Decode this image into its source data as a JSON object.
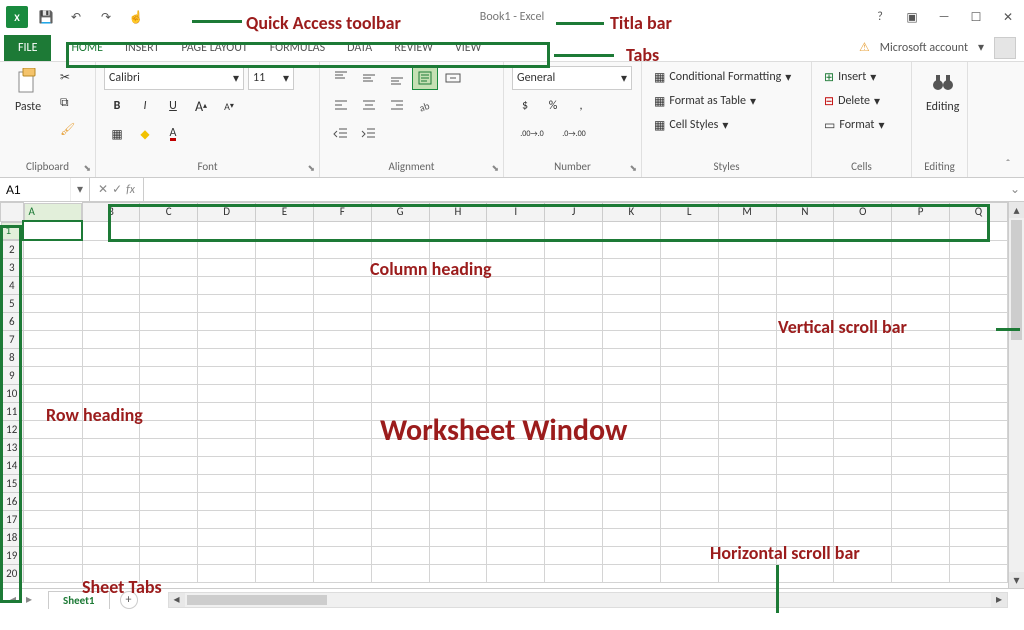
{
  "titlebar": {
    "app_letter": "X",
    "title": "Book1 - Excel",
    "help_glyph": "?",
    "restore_glyph": "▣",
    "min_glyph": "—",
    "max_glyph": "☐",
    "close_glyph": "✕"
  },
  "qat": {
    "save_glyph": "💾",
    "undo_glyph": "↶",
    "redo_glyph": "↷",
    "touch_glyph": "☝"
  },
  "tabs": {
    "file": "FILE",
    "items": [
      {
        "label": "HOME"
      },
      {
        "label": "INSERT"
      },
      {
        "label": "PAGE LAYOUT"
      },
      {
        "label": "FORMULAS"
      },
      {
        "label": "DATA"
      },
      {
        "label": "REVIEW"
      },
      {
        "label": "VIEW"
      }
    ]
  },
  "account": {
    "warn_glyph": "⚠",
    "label": "Microsoft account",
    "dd_glyph": "▾"
  },
  "ribbon": {
    "clipboard": {
      "paste": "Paste",
      "cut_glyph": "✂",
      "copy_glyph": "⧉",
      "painter_glyph": "🖌",
      "label": "Clipboard"
    },
    "font": {
      "name": "Calibri",
      "size": "11",
      "bold": "B",
      "italic": "I",
      "underline": "U",
      "grow": "A",
      "shrink": "A",
      "border_glyph": "▦",
      "fill_glyph": "◆",
      "color_glyph": "A",
      "label": "Font",
      "dd": "▾"
    },
    "alignment": {
      "label": "Alignment"
    },
    "number": {
      "format": "General",
      "currency": "$",
      "percent": "%",
      "comma": ",",
      "inc": ".00→.0",
      "dec": ".0→.00",
      "label": "Number",
      "dd": "▾"
    },
    "styles": {
      "cond": "Conditional Formatting",
      "table": "Format as Table",
      "cell": "Cell Styles",
      "label": "Styles",
      "dd": "▾"
    },
    "cells": {
      "insert": "Insert",
      "delete": "Delete",
      "format": "Format",
      "label": "Cells",
      "dd": "▾"
    },
    "editing": {
      "label": "Editing"
    },
    "launcher": "⬊",
    "collapse_glyph": "ˆ"
  },
  "namebox": {
    "value": "A1",
    "dd": "▾"
  },
  "fxbar": {
    "cancel": "✕",
    "enter": "✓",
    "fx": "fx",
    "value": "",
    "expand": "⌄"
  },
  "grid": {
    "cols": [
      "A",
      "B",
      "C",
      "D",
      "E",
      "F",
      "G",
      "H",
      "I",
      "J",
      "K",
      "L",
      "M",
      "N",
      "O",
      "P",
      "Q"
    ],
    "rows": [
      "1",
      "2",
      "3",
      "4",
      "5",
      "6",
      "7",
      "8",
      "9",
      "10",
      "11",
      "12",
      "13",
      "14",
      "15",
      "16",
      "17",
      "18",
      "19",
      "20"
    ],
    "active_cell": "A1"
  },
  "sheetbar": {
    "nav_first": "◂",
    "nav_prev": "▸",
    "sheet_name": "Sheet1",
    "add": "+"
  },
  "scroll": {
    "up": "▴",
    "down": "▾",
    "left": "◂",
    "right": "▸"
  },
  "annotations": {
    "qat": "Quick Access toolbar",
    "titlebar": "Titla bar",
    "tabs": "Tabs",
    "colhead": "Column heading",
    "rowhead": "Row heading",
    "worksheet": "Worksheet Window",
    "vscroll": "Vertical scroll bar",
    "hscroll": "Horizontal scroll bar",
    "sheettabs": "Sheet Tabs"
  }
}
